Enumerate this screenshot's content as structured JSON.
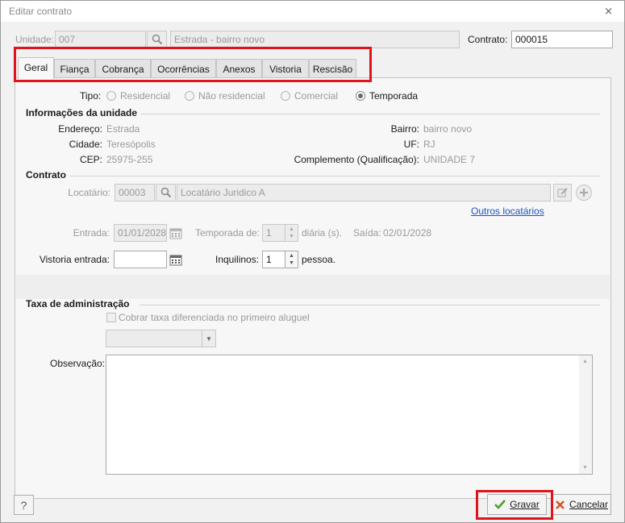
{
  "window": {
    "title": "Editar contrato"
  },
  "header": {
    "unidade_label": "Unidade:",
    "unidade_value": "007",
    "unidade_desc": "Estrada  - bairro novo",
    "contrato_label": "Contrato:",
    "contrato_value": "000015"
  },
  "tabs": [
    {
      "label": "Geral",
      "active": true
    },
    {
      "label": "Fiança"
    },
    {
      "label": "Cobrança"
    },
    {
      "label": "Ocorrências"
    },
    {
      "label": "Anexos"
    },
    {
      "label": "Vistoria"
    },
    {
      "label": "Rescisão"
    }
  ],
  "tipo": {
    "label": "Tipo:",
    "options": [
      "Residencial",
      "Não residencial",
      "Comercial",
      "Temporada"
    ],
    "selected": "Temporada"
  },
  "info_unidade": {
    "title": "Informações da unidade",
    "endereco_label": "Endereço:",
    "endereco": "Estrada",
    "cidade_label": "Cidade:",
    "cidade": "Teresópolis",
    "cep_label": "CEP:",
    "cep": "25975-255",
    "bairro_label": "Bairro:",
    "bairro": "bairro novo",
    "uf_label": "UF:",
    "uf": "RJ",
    "complemento_label": "Complemento (Qualificação):",
    "complemento": "UNIDADE 7"
  },
  "contrato": {
    "title": "Contrato",
    "locatario_label": "Locatário:",
    "locatario_code": "00003",
    "locatario_name": "Locatário Juridico A",
    "outros_link": "Outros locatários",
    "entrada_label": "Entrada:",
    "entrada_value": "01/01/2028",
    "temporada_label": "Temporada de:",
    "temporada_value": "1",
    "diarias_label": "diária (s).",
    "saida_label": "Saída:",
    "saida_value": "02/01/2028",
    "vistoria_label": "Vistoria entrada:",
    "vistoria_value": "",
    "inquilinos_label": "Inquilinos:",
    "inquilinos_value": "1",
    "pessoa_label": "pessoa."
  },
  "taxa": {
    "title": "Taxa de administração",
    "cobrar_label": "Cobrar taxa diferenciada no primeiro aluguel",
    "select_value": ""
  },
  "observacao": {
    "label": "Observação:",
    "value": ""
  },
  "footer": {
    "help_label": "?",
    "gravar_label": "Gravar",
    "cancelar_label": "Cancelar"
  },
  "colors": {
    "highlight": "#e0141a",
    "link": "#1a56c8",
    "check": "#4aa02c",
    "cancel": "#d9502a"
  }
}
